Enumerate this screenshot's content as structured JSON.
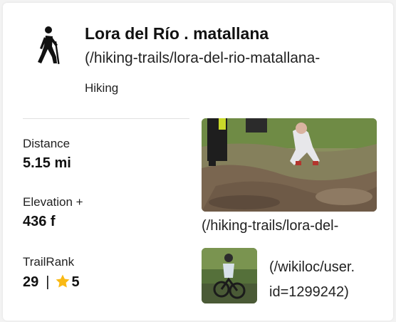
{
  "trail": {
    "title": "Lora del Río . matallana",
    "link_text": "(/hiking-trails/lora-del-rio-matallana-",
    "activity_type": "Hiking",
    "activity_icon": "hiker-icon"
  },
  "stats": {
    "distance_label": "Distance",
    "distance_value": "5.15 mi",
    "elevation_label": "Elevation +",
    "elevation_value": "436 f",
    "trailrank_label": "TrailRank",
    "trailrank_value": "29",
    "trailrank_separator": "|",
    "rating_icon": "star-icon",
    "rating_value": "5"
  },
  "photo": {
    "link_text": "(/hiking-trails/lora-del-"
  },
  "user": {
    "link_line1": "(/wikiloc/user.",
    "link_line2": "id=1299242)"
  },
  "colors": {
    "star": "#f9b914",
    "text": "#212121"
  }
}
